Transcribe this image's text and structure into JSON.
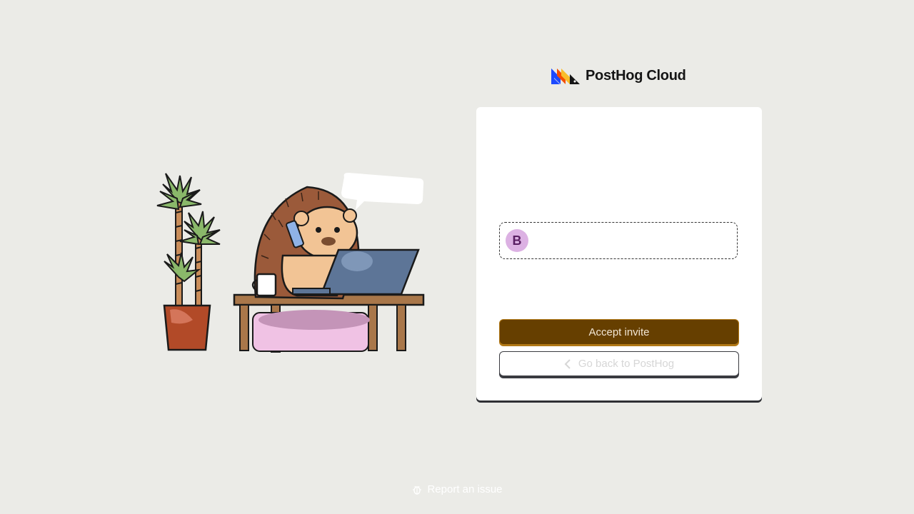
{
  "brand": {
    "name": "PostHog Cloud",
    "logo_icon": "posthog-hedgehog-logo-icon",
    "colors": {
      "blue": "#1d4aff",
      "orange": "#f54e00",
      "yellow": "#f9bd2b",
      "dark": "#151515"
    }
  },
  "illustration": {
    "icon": "hedgehog-working-at-desk-illustration"
  },
  "invite": {
    "avatar_initial": "B",
    "avatar_color": "#dcb1e3"
  },
  "actions": {
    "accept_label": "Accept invite",
    "back_label": "Go back to PostHog",
    "back_icon": "chevron-left-icon"
  },
  "footer": {
    "report_label": "Report an issue",
    "report_icon": "bug-icon"
  }
}
